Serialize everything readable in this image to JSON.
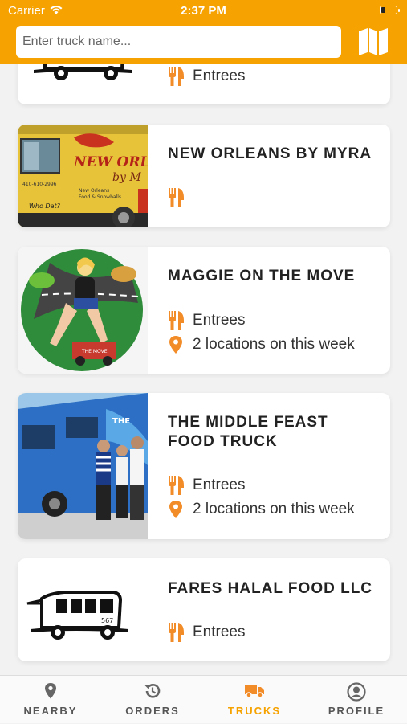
{
  "status_bar": {
    "carrier": "Carrier",
    "time": "2:37 PM"
  },
  "header": {
    "search_placeholder": "Enter truck name...",
    "map_icon": "map-icon"
  },
  "colors": {
    "accent": "#f6a200",
    "icon_orange": "#f28c28"
  },
  "cards": [
    {
      "title": "",
      "category": "Entrees",
      "locations": ""
    },
    {
      "title": "NEW ORLEANS BY MYRA",
      "category": "",
      "locations": ""
    },
    {
      "title": "MAGGIE ON THE MOVE",
      "category": "Entrees",
      "locations": "2 locations on this week"
    },
    {
      "title": "THE MIDDLE FEAST FOOD TRUCK",
      "category": "Entrees",
      "locations": "2 locations on this week"
    },
    {
      "title": "FARES HALAL FOOD LLC",
      "category": "Entrees",
      "locations": ""
    }
  ],
  "tabs": [
    {
      "label": "NEARBY",
      "icon": "location-pin-icon",
      "active": false
    },
    {
      "label": "ORDERS",
      "icon": "history-icon",
      "active": false
    },
    {
      "label": "TRUCKS",
      "icon": "truck-icon",
      "active": true
    },
    {
      "label": "PROFILE",
      "icon": "profile-icon",
      "active": false
    }
  ]
}
